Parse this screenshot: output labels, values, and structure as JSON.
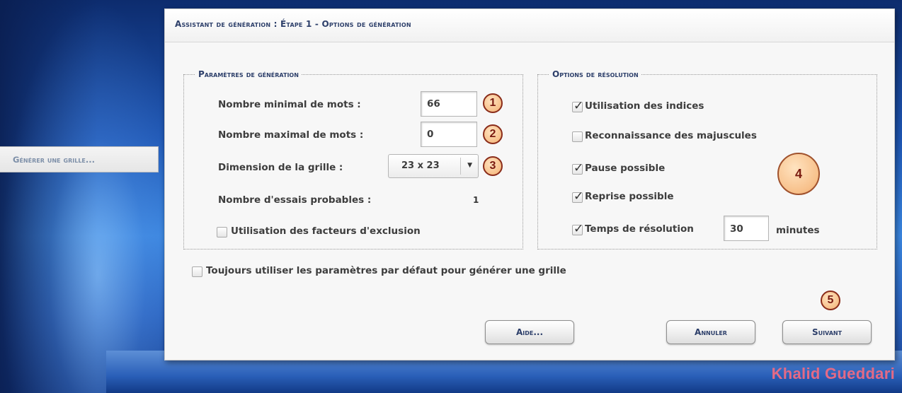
{
  "side_tab": {
    "label": "Générer une grille..."
  },
  "dialog": {
    "title": "Assistant de génération : Étape 1 - Options de génération",
    "generation_params": {
      "legend": "Paramètres de génération",
      "min_words_label": "Nombre minimal de mots :",
      "min_words_value": "66",
      "max_words_label": "Nombre maximal de mots :",
      "max_words_value": "0",
      "grid_size_label": "Dimension de la grille :",
      "grid_size_value": "23 x 23",
      "probable_tries_label": "Nombre d'essais probables :",
      "probable_tries_value": "1",
      "exclusion_factors_label": "Utilisation des facteurs d'exclusion",
      "exclusion_factors_checked": false
    },
    "resolution_options": {
      "legend": "Options de résolution",
      "hints_label": "Utilisation des indices",
      "hints_checked": true,
      "uppercase_label": "Reconnaissance des majuscules",
      "uppercase_checked": false,
      "pause_label": "Pause possible",
      "pause_checked": true,
      "resume_label": "Reprise possible",
      "resume_checked": true,
      "time_label": "Temps de résolution",
      "time_checked": true,
      "time_value": "30",
      "time_unit": "minutes"
    },
    "always_default_label": "Toujours utiliser les paramètres par défaut pour générer une grille",
    "always_default_checked": false,
    "buttons": {
      "help": "Aide...",
      "cancel": "Annuler",
      "next": "Suivant"
    }
  },
  "annotations": {
    "n1": "1",
    "n2": "2",
    "n3": "3",
    "n4": "4",
    "n5": "5"
  },
  "watermark": "Khalid Gueddari",
  "icons": {
    "check": "check-icon",
    "dropdown": "chevron-down-icon"
  }
}
